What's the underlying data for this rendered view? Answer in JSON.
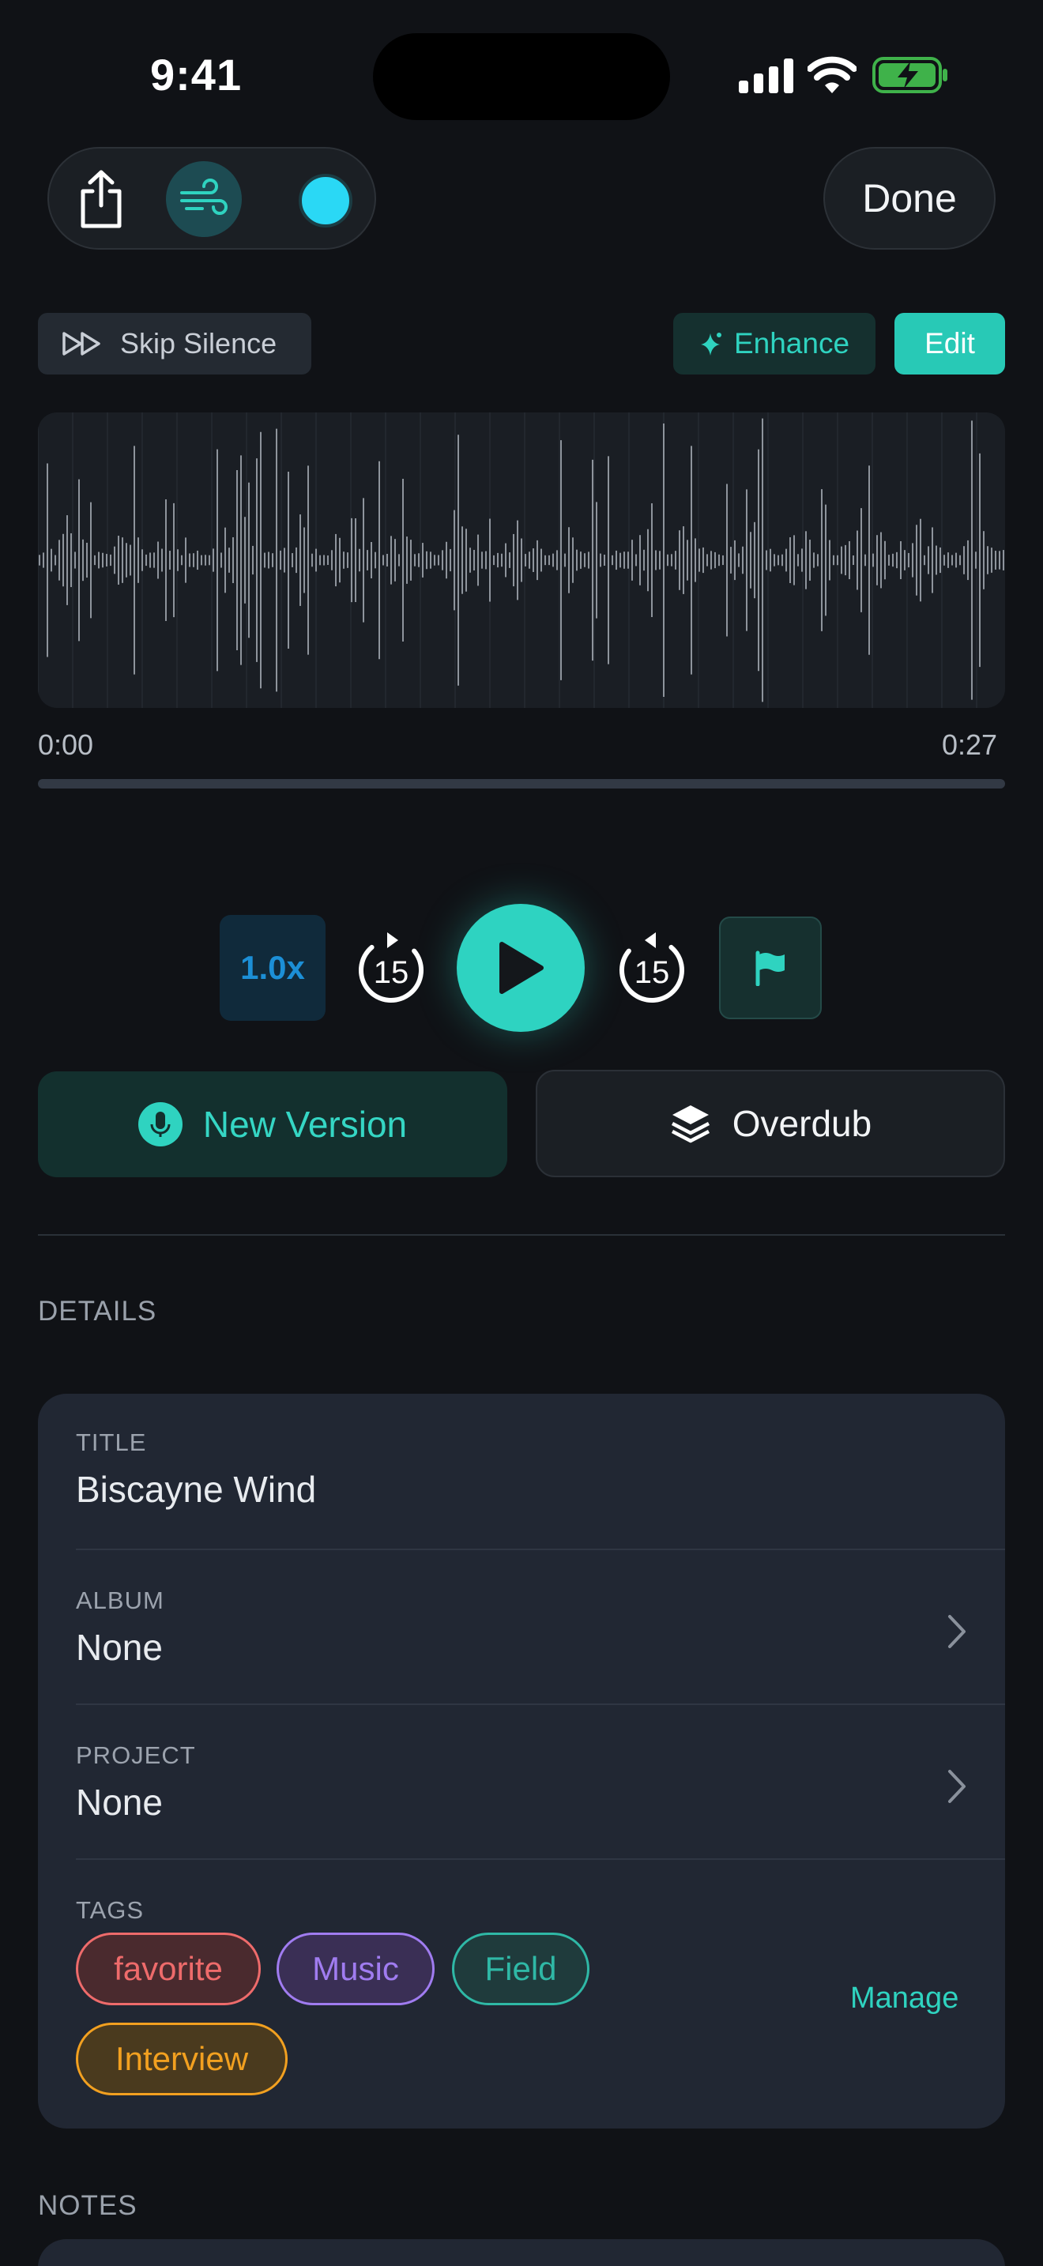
{
  "status": {
    "time": "9:41"
  },
  "toolbar": {
    "done_label": "Done",
    "color_dot": "#2ad8f5"
  },
  "actions": {
    "skip_silence": "Skip Silence",
    "enhance": "Enhance",
    "edit": "Edit"
  },
  "player": {
    "time_start": "0:00",
    "time_end": "0:27",
    "progress": 0,
    "speed": "1.0x",
    "skip_back": "15",
    "skip_forward": "15"
  },
  "version": {
    "new_version": "New Version",
    "overdub": "Overdub"
  },
  "details": {
    "section": "DETAILS",
    "title_label": "TITLE",
    "title_value": "Biscayne Wind",
    "album_label": "ALBUM",
    "album_value": "None",
    "project_label": "PROJECT",
    "project_value": "None",
    "tags_label": "TAGS",
    "tags": [
      {
        "label": "favorite",
        "color": "#ee6b6b",
        "bg": "#4a2a2e"
      },
      {
        "label": "Music",
        "color": "#a07cf0",
        "bg": "#3a2f55"
      },
      {
        "label": "Field",
        "color": "#2fb8a6",
        "bg": "#1f3b3c"
      },
      {
        "label": "Interview",
        "color": "#f2a020",
        "bg": "#4a3a1e"
      }
    ],
    "manage": "Manage"
  },
  "notes": {
    "section": "NOTES"
  },
  "colors": {
    "accent": "#28c9b6",
    "background": "#101216",
    "card": "#212733"
  }
}
